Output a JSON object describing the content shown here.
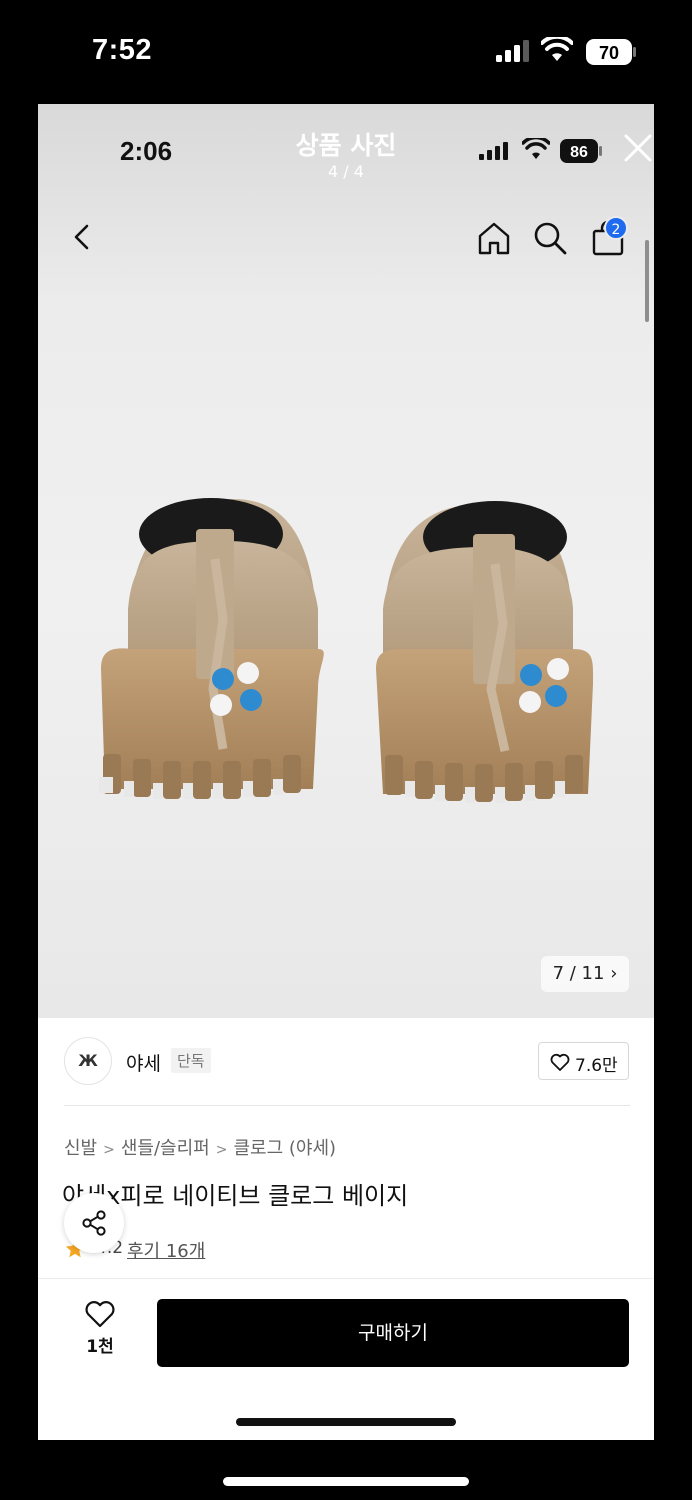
{
  "outer_status": {
    "time": "7:52",
    "battery": "70"
  },
  "viewer": {
    "inner_time": "2:06",
    "title": "상품 사진",
    "counter": "4 / 4",
    "inner_battery": "86"
  },
  "header": {
    "cart_badge": "2"
  },
  "photo": {
    "pager": "7 / 11",
    "pager_arrow": "›"
  },
  "brand": {
    "logo_text": "Ж",
    "name": "야세",
    "tag": "단독",
    "likes": "7.6만"
  },
  "breadcrumb": [
    "신발",
    "샌들/슬리퍼",
    "클로그 (야세)"
  ],
  "product": {
    "name": "야세x피로 네이티브 클로그 베이지",
    "rating": "4.2",
    "review_label": "후기 16개"
  },
  "bottom_bar": {
    "wish_count": "1천",
    "buy_label": "구매하기"
  },
  "colors": {
    "badge_blue": "#1e6bf0",
    "buy_button": "#000000",
    "star": "#f5a623"
  },
  "icons": [
    "back-icon",
    "home-icon",
    "search-icon",
    "cart-icon",
    "close-icon",
    "heart-icon",
    "share-icon",
    "star-icon",
    "wifi-icon",
    "signal-icon",
    "battery-icon"
  ]
}
